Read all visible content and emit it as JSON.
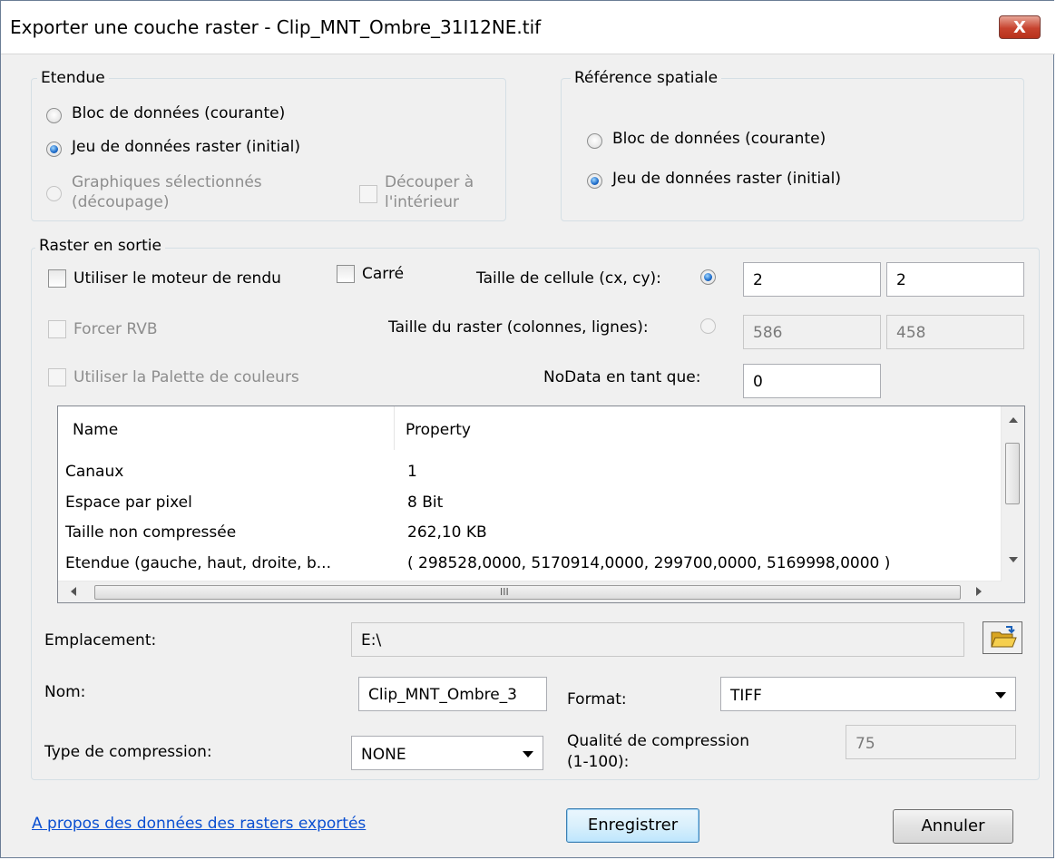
{
  "window": {
    "title": "Exporter une couche raster - Clip_MNT_Ombre_31I12NE.tif",
    "close_label": "X"
  },
  "etendue": {
    "legend": "Etendue",
    "option1": "Bloc de données (courante)",
    "option2": "Jeu de données raster (initial)",
    "option3_line1": "Graphiques sélectionnés",
    "option3_line2": "(découpage)",
    "clip_line1": "Découper à",
    "clip_line2": "l'intérieur",
    "selected": "option2"
  },
  "reference": {
    "legend": "Référence spatiale",
    "option1": "Bloc de données (courante)",
    "option2": "Jeu de données raster (initial)",
    "selected": "option2"
  },
  "raster": {
    "legend": "Raster en sortie",
    "use_renderer": "Utiliser le moteur de rendu",
    "square": "Carré",
    "force_rgb": "Forcer RVB",
    "use_palette": "Utiliser la Palette de couleurs",
    "cell_size_label": "Taille de cellule (cx, cy):",
    "cell_cx": "2",
    "cell_cy": "2",
    "raster_size_label": "Taille du raster (colonnes, lignes):",
    "cols": "586",
    "rows": "458",
    "nodata_label": "NoData en tant que:",
    "nodata_value": "0"
  },
  "table": {
    "headers": [
      "Name",
      "Property"
    ],
    "rows": [
      [
        "Canaux",
        "1"
      ],
      [
        "Espace par pixel",
        "8 Bit"
      ],
      [
        "Taille non compressée",
        "262,10 KB"
      ],
      [
        "Etendue (gauche, haut, droite, b...",
        "( 298528,0000, 5170914,0000, 299700,0000, 5169998,0000 )"
      ]
    ],
    "scroll_grip": "III"
  },
  "location": {
    "label": "Emplacement:",
    "value": "E:\\"
  },
  "name": {
    "label": "Nom:",
    "value": "Clip_MNT_Ombre_3"
  },
  "format": {
    "label": "Format:",
    "value": "TIFF"
  },
  "compression": {
    "label": "Type de compression:",
    "value": "NONE"
  },
  "quality": {
    "label_line1": "Qualité de compression",
    "label_line2": "(1-100):",
    "value": "75"
  },
  "footer": {
    "link": "A propos des données des rasters exportés",
    "save": "Enregistrer",
    "cancel": "Annuler"
  }
}
